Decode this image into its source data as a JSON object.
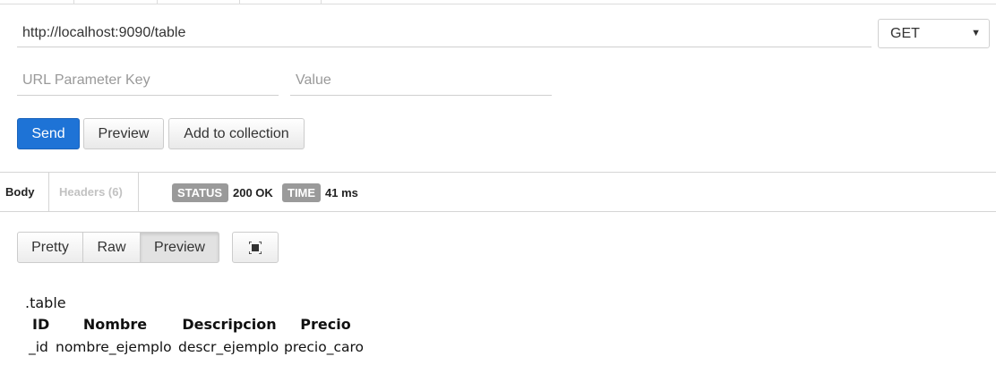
{
  "request": {
    "url": "http://localhost:9090/table",
    "method": "GET",
    "param_key_placeholder": "URL Parameter Key",
    "param_value_placeholder": "Value"
  },
  "actions": {
    "send": "Send",
    "preview": "Preview",
    "add_to_collection": "Add to collection"
  },
  "response": {
    "tabs": {
      "body": "Body",
      "headers": "Headers (6)"
    },
    "status_label": "STATUS",
    "status_value": "200 OK",
    "time_label": "TIME",
    "time_value": "41 ms",
    "view_modes": {
      "pretty": "Pretty",
      "raw": "Raw",
      "preview": "Preview"
    },
    "expand_icon": "expand-icon"
  },
  "preview": {
    "caption": ".table",
    "headers": [
      "ID",
      "Nombre",
      "Descripcion",
      "Precio"
    ],
    "rows": [
      [
        "_id",
        "nombre_ejemplo",
        "descr_ejemplo",
        "precio_caro"
      ]
    ]
  },
  "colors": {
    "send_button": "#1e73d6",
    "badge": "#9a9a9a"
  }
}
